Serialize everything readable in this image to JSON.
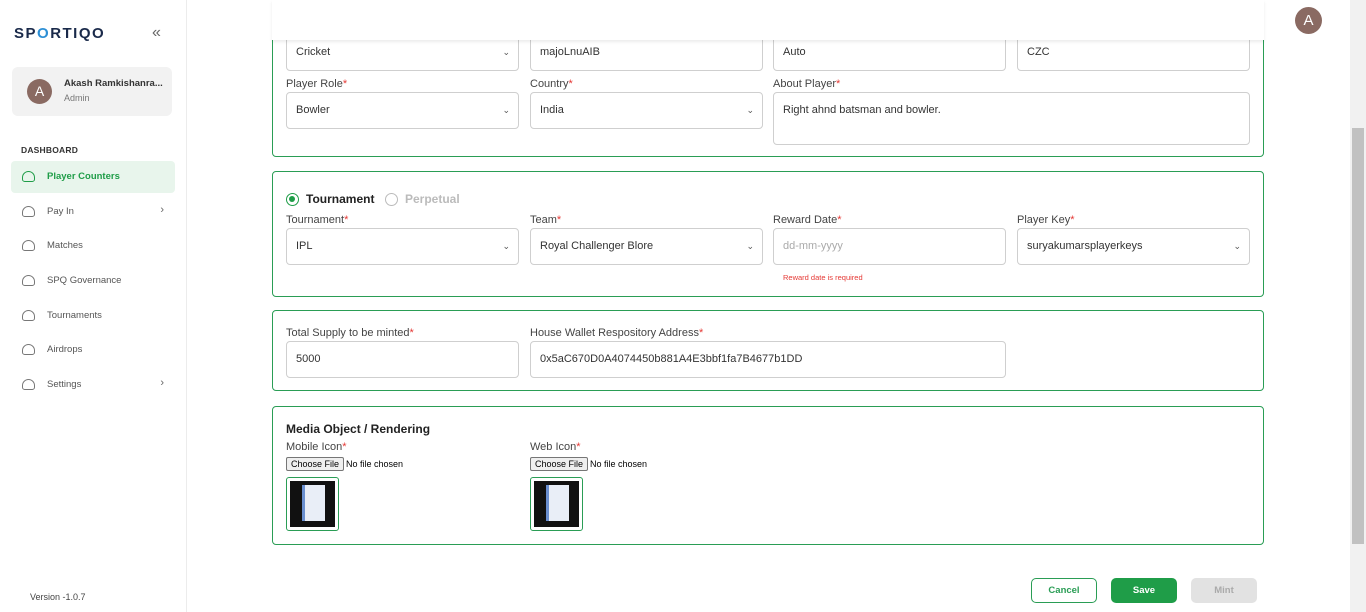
{
  "sidebar": {
    "logo": "SP_RTIQO",
    "logo_left": "SP",
    "logo_o": "O",
    "logo_right": "RTIQO",
    "collapse_glyph": "«",
    "user": {
      "initial": "A",
      "name": "Akash Ramkishanra...",
      "role": "Admin"
    },
    "section": "DASHBOARD",
    "items": [
      {
        "label": "Player Counters",
        "active": true,
        "chevron": false,
        "icon": "gauge-icon"
      },
      {
        "label": "Pay In",
        "active": false,
        "chevron": true,
        "icon": "gauge-icon"
      },
      {
        "label": "Matches",
        "active": false,
        "chevron": false,
        "icon": "gauge-icon"
      },
      {
        "label": "SPQ Governance",
        "active": false,
        "chevron": false,
        "icon": "gauge-icon"
      },
      {
        "label": "Tournaments",
        "active": false,
        "chevron": false,
        "icon": "gauge-icon"
      },
      {
        "label": "Airdrops",
        "active": false,
        "chevron": false,
        "icon": "gauge-icon"
      },
      {
        "label": "Settings",
        "active": false,
        "chevron": true,
        "icon": "gauge-icon"
      }
    ],
    "version": "Version -1.0.7"
  },
  "header": {
    "avatar_initial": "A"
  },
  "player": {
    "sport": "Cricket",
    "player_name": "majoLnuAIB",
    "last_name": "Auto",
    "short_name": "CZC",
    "role_label": "Player Role",
    "role": "Bowler",
    "country_label": "Country",
    "country": "India",
    "about_label": "About Player",
    "about": "Right ahnd batsman and bowler."
  },
  "reward": {
    "tournament_option": "Tournament",
    "perpetual_option": "Perpetual",
    "tournament_label": "Tournament",
    "tournament": "IPL",
    "team_label": "Team",
    "team": "Royal Challenger Blore",
    "reward_date_label": "Reward Date",
    "reward_date_placeholder": "dd-mm-yyyy",
    "reward_date_error": "Reward date is required",
    "player_key_label": "Player Key",
    "player_key": "suryakumarsplayerkeys"
  },
  "supply": {
    "total_label": "Total Supply to be minted",
    "total": "5000",
    "wallet_label": "House Wallet Respository Address",
    "wallet": "0x5aC670D0A4074450b881A4E3bbf1fa7B4677b1DD"
  },
  "media": {
    "title": "Media Object / Rendering",
    "mobile_label": "Mobile Icon",
    "web_label": "Web Icon",
    "choose_file": "Choose File",
    "no_file": "No file chosen"
  },
  "actions": {
    "cancel": "Cancel",
    "save": "Save",
    "mint": "Mint"
  },
  "required_mark": "*",
  "colors": {
    "accent": "#1f9d48",
    "error": "#e53935"
  }
}
